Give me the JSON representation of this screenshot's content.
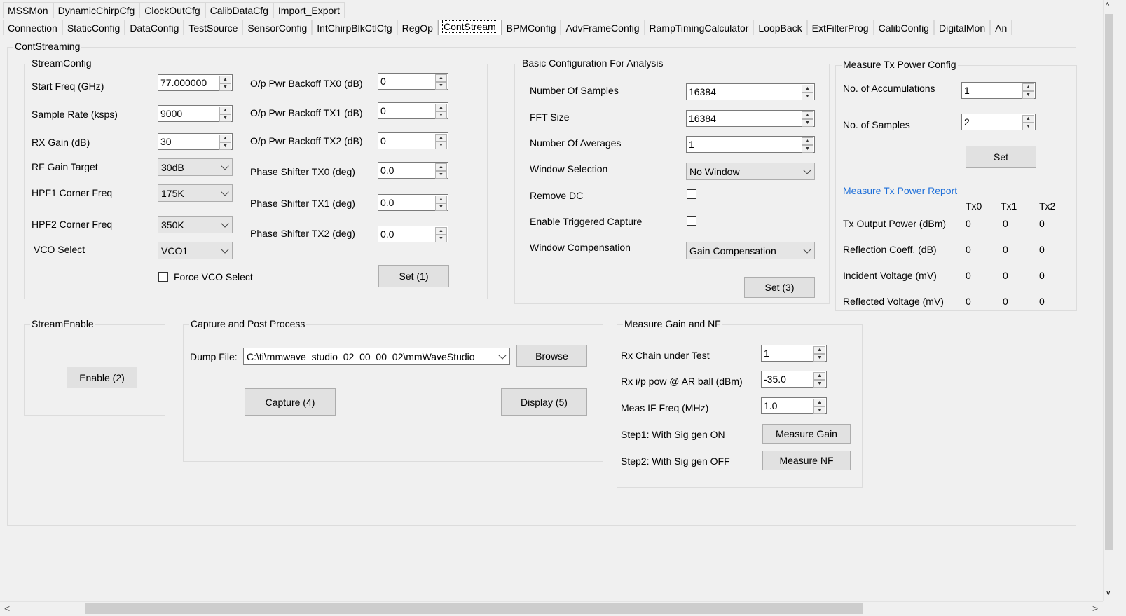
{
  "tabs_top": [
    "MSSMon",
    "DynamicChirpCfg",
    "ClockOutCfg",
    "CalibDataCfg",
    "Import_Export"
  ],
  "tabs_main": [
    "Connection",
    "StaticConfig",
    "DataConfig",
    "TestSource",
    "SensorConfig",
    "IntChirpBlkCtlCfg",
    "RegOp",
    "ContStream",
    "BPMConfig",
    "AdvFrameConfig",
    "RampTimingCalculator",
    "LoopBack",
    "ExtFilterProg",
    "CalibConfig",
    "DigitalMon",
    "An"
  ],
  "active_tab": "ContStream",
  "cont_streaming": {
    "title": "ContStreaming"
  },
  "stream_config": {
    "title": "StreamConfig",
    "start_freq": {
      "label": "Start Freq (GHz)",
      "value": "77.000000"
    },
    "sample_rate": {
      "label": "Sample Rate (ksps)",
      "value": "9000"
    },
    "rx_gain": {
      "label": "RX Gain (dB)",
      "value": "30"
    },
    "rf_gain_target": {
      "label": "RF Gain Target",
      "value": "30dB"
    },
    "hpf1": {
      "label": "HPF1 Corner Freq",
      "value": "175K"
    },
    "hpf2": {
      "label": "HPF2 Corner Freq",
      "value": "350K"
    },
    "vco_select": {
      "label": "VCO Select",
      "value": "VCO1"
    },
    "force_vco": {
      "label": "Force VCO Select",
      "checked": false
    },
    "backoff_tx0": {
      "label": "O/p Pwr Backoff TX0 (dB)",
      "value": "0"
    },
    "backoff_tx1": {
      "label": "O/p Pwr Backoff TX1 (dB)",
      "value": "0"
    },
    "backoff_tx2": {
      "label": "O/p Pwr Backoff TX2 (dB)",
      "value": "0"
    },
    "phase_tx0": {
      "label": "Phase Shifter TX0 (deg)",
      "value": "0.0"
    },
    "phase_tx1": {
      "label": "Phase Shifter TX1 (deg)",
      "value": "0.0"
    },
    "phase_tx2": {
      "label": "Phase Shifter TX2 (deg)",
      "value": "0.0"
    },
    "set_button": "Set (1)"
  },
  "basic_config": {
    "title": "Basic Configuration For Analysis",
    "num_samples": {
      "label": "Number Of Samples",
      "value": "16384"
    },
    "fft_size": {
      "label": "FFT Size",
      "value": "16384"
    },
    "num_averages": {
      "label": "Number Of Averages",
      "value": "1"
    },
    "window_selection": {
      "label": "Window Selection",
      "value": "No Window"
    },
    "remove_dc": {
      "label": "Remove DC",
      "checked": false
    },
    "triggered_capture": {
      "label": "Enable Triggered Capture",
      "checked": false
    },
    "window_compensation": {
      "label": "Window Compensation",
      "value": "Gain Compensation"
    },
    "set_button": "Set (3)"
  },
  "tx_power_config": {
    "title": "Measure Tx Power Config",
    "accumulations": {
      "label": "No. of Accumulations",
      "value": "1"
    },
    "samples": {
      "label": "No. of Samples",
      "value": "2"
    },
    "set_button": "Set",
    "report_title": "Measure Tx Power Report",
    "columns": [
      "Tx0",
      "Tx1",
      "Tx2"
    ],
    "rows": [
      {
        "label": "Tx Output Power (dBm)",
        "values": [
          "0",
          "0",
          "0"
        ]
      },
      {
        "label": "Reflection Coeff.  (dB)",
        "values": [
          "0",
          "0",
          "0"
        ]
      },
      {
        "label": "Incident Voltage (mV)",
        "values": [
          "0",
          "0",
          "0"
        ]
      },
      {
        "label": "Reflected Voltage (mV)",
        "values": [
          "0",
          "0",
          "0"
        ]
      }
    ]
  },
  "stream_enable": {
    "title": "StreamEnable",
    "button": "Enable (2)"
  },
  "capture": {
    "title": "Capture and Post Process",
    "dump_label": "Dump File:",
    "dump_value": "C:\\ti\\mmwave_studio_02_00_00_02\\mmWaveStudio",
    "browse": "Browse",
    "capture_button": "Capture (4)",
    "display_button": "Display (5)"
  },
  "gain_nf": {
    "title": "Measure Gain and NF",
    "rx_chain": {
      "label": "Rx Chain under Test",
      "value": "1"
    },
    "rx_pow": {
      "label": "Rx i/p pow @ AR ball (dBm)",
      "value": "-35.0"
    },
    "meas_if": {
      "label": "Meas IF Freq (MHz)",
      "value": "1.0"
    },
    "step1": {
      "label": "Step1: With Sig gen ON",
      "button": "Measure Gain"
    },
    "step2": {
      "label": "Step2: With Sig gen OFF",
      "button": "Measure NF"
    }
  },
  "scroll": {
    "left_arrow": "<",
    "right_arrow": ">",
    "up_arrow": "^",
    "down_arrow": "v"
  }
}
